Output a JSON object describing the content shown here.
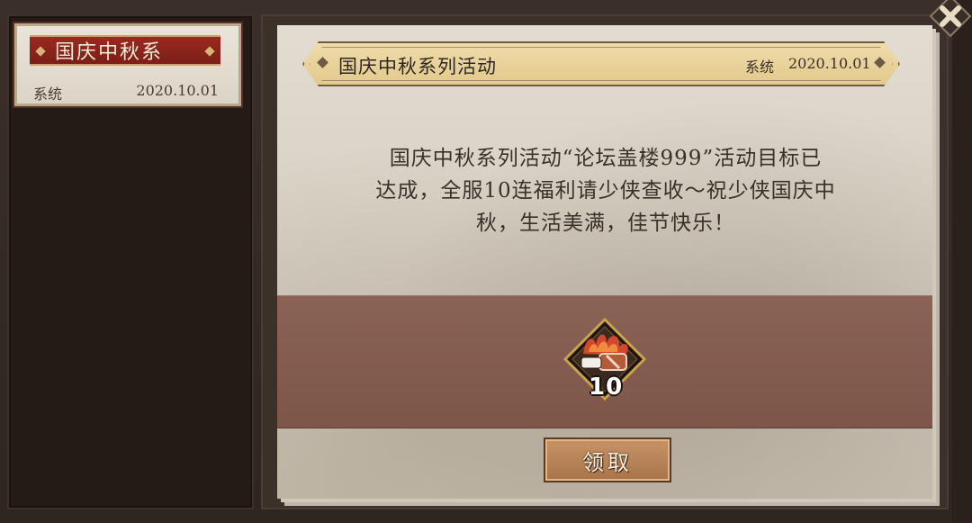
{
  "sidebar": {
    "items": [
      {
        "title": "国庆中秋系",
        "sender": "系统",
        "date": "2020.10.01",
        "selected": true
      }
    ]
  },
  "mail": {
    "title": "国庆中秋系列活动",
    "sender": "系统",
    "date": "2020.10.01",
    "body_lines": [
      "国庆中秋系列活动“论坛盖楼999”活动目标已",
      "达成，全服10连福利请少侠查收～祝少侠国庆中",
      "秋，生活美满，佳节快乐！"
    ]
  },
  "reward": {
    "icon": "ten-pull-ticket-icon",
    "count": "10"
  },
  "actions": {
    "claim_label": "领取"
  },
  "window": {
    "close_icon": "close-x-icon"
  },
  "colors": {
    "ribbon_red": "#8e241c",
    "header_gold": "#e9d39b",
    "reward_band": "#835c4f",
    "button": "#b88058"
  }
}
